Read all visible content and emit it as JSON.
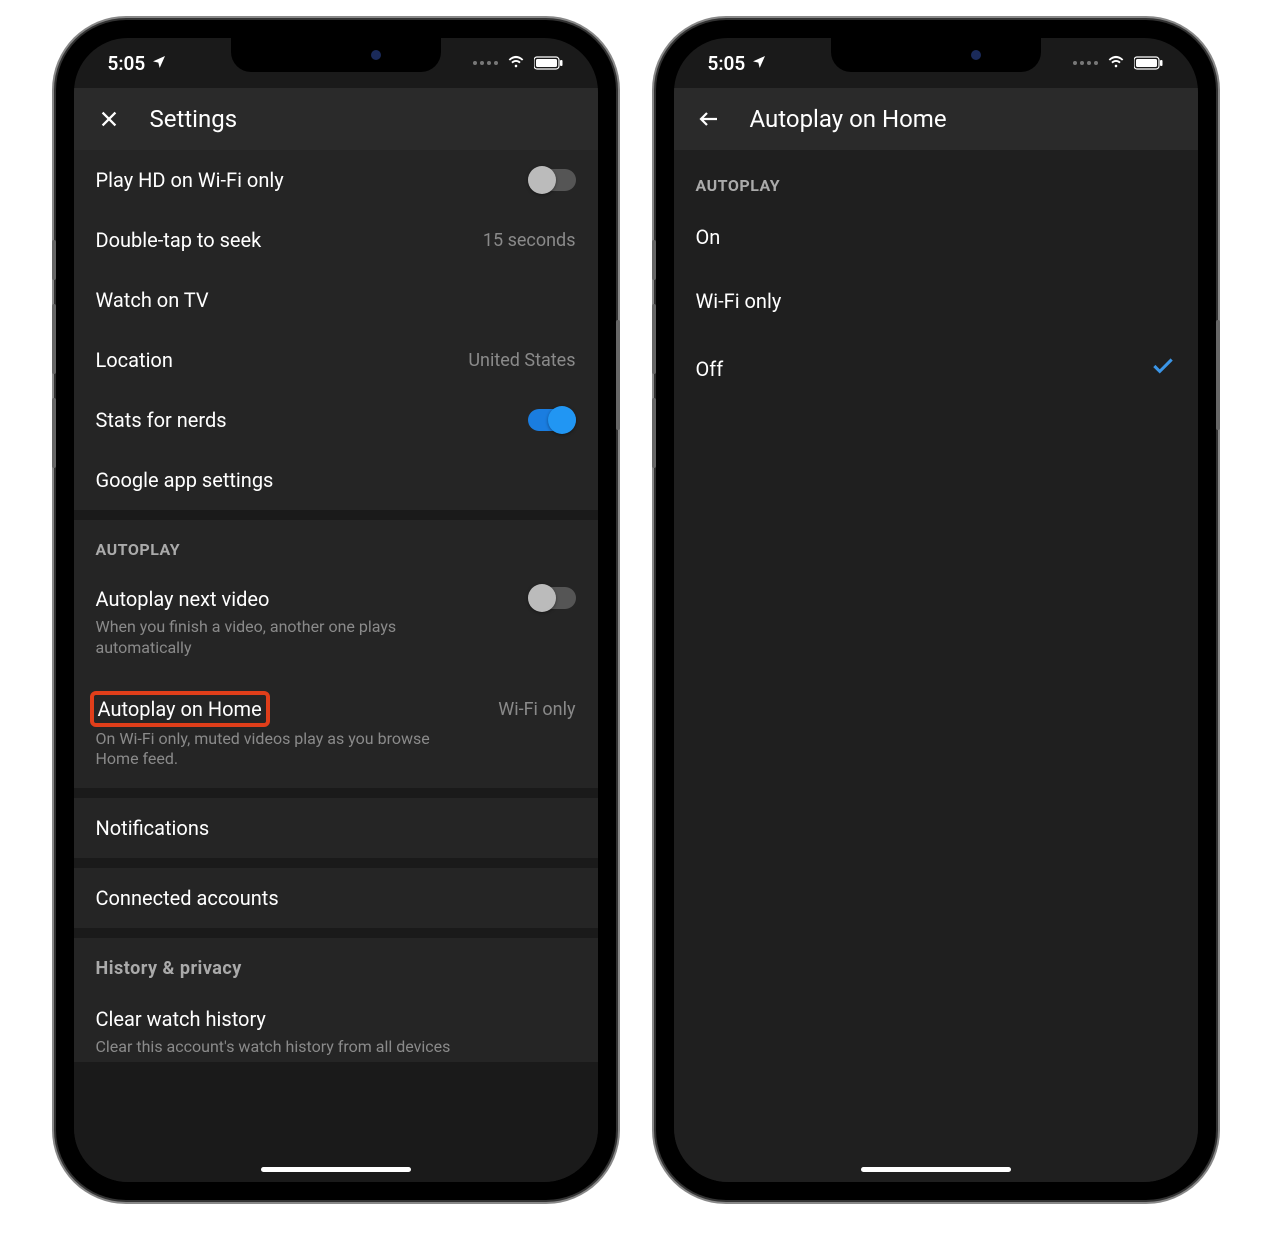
{
  "status": {
    "time": "5:05"
  },
  "left": {
    "header_title": "Settings",
    "rows": {
      "play_hd": "Play HD on Wi-Fi only",
      "double_tap": "Double-tap to seek",
      "double_tap_val": "15 seconds",
      "watch_tv": "Watch on TV",
      "location": "Location",
      "location_val": "United States",
      "stats": "Stats for nerds",
      "google": "Google app settings"
    },
    "autoplay_header": "AUTOPLAY",
    "autoplay_next": "Autoplay next video",
    "autoplay_next_sub": "When you finish a video, another one plays automatically",
    "autoplay_home": "Autoplay on Home",
    "autoplay_home_val": "Wi-Fi only",
    "autoplay_home_sub": "On Wi-Fi only, muted videos play as you browse Home feed.",
    "notifications": "Notifications",
    "connected": "Connected accounts",
    "history_header": "History & privacy",
    "clear_watch": "Clear watch history",
    "clear_watch_sub": "Clear this account's watch history from all devices"
  },
  "right": {
    "header_title": "Autoplay on Home",
    "section_header": "AUTOPLAY",
    "options": [
      "On",
      "Wi-Fi only",
      "Off"
    ],
    "selected_index": 2
  }
}
